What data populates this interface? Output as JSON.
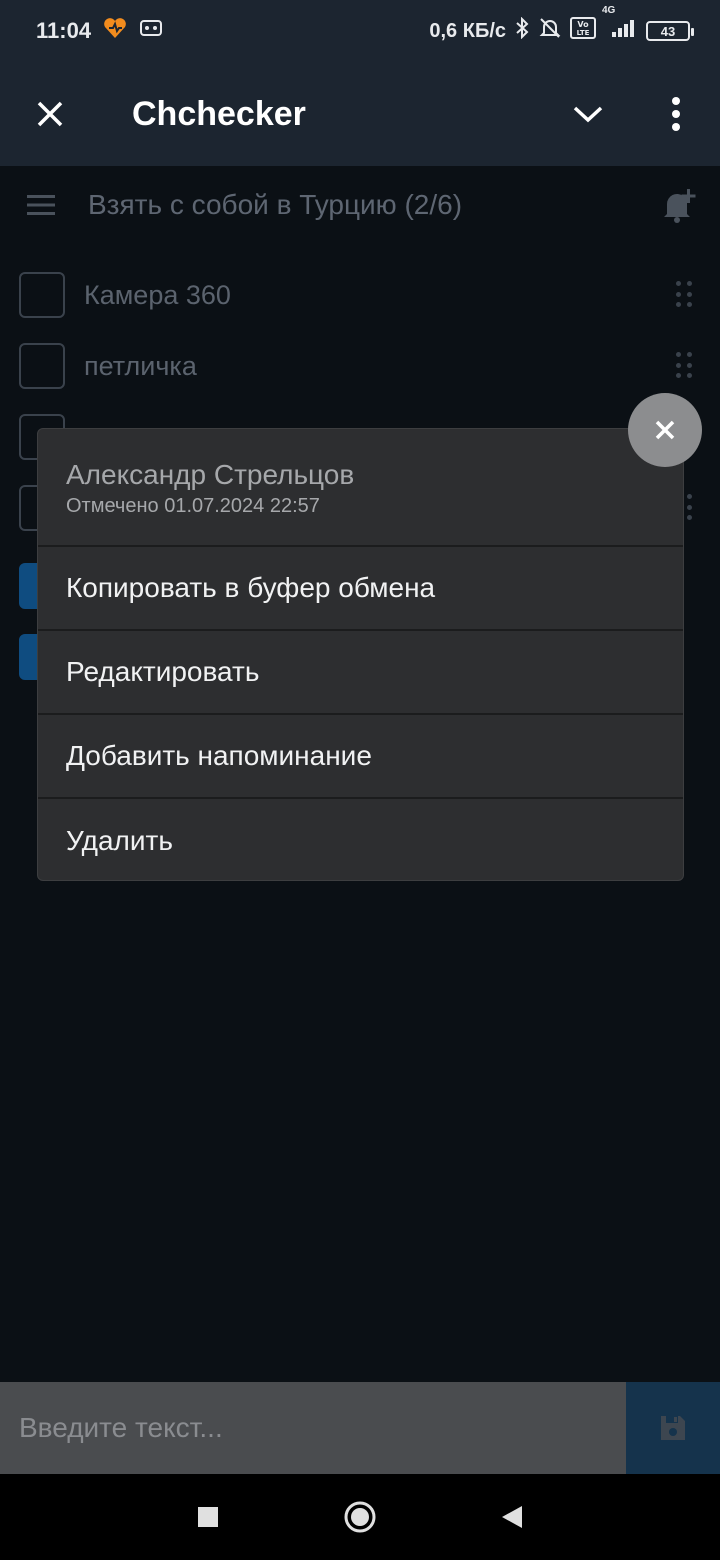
{
  "status_bar": {
    "time": "11:04",
    "speed": "0,6 КБ/с",
    "network": "4G",
    "battery": "43"
  },
  "app_bar": {
    "title": "Chchecker"
  },
  "list": {
    "title": "Взять с собой в Турцию (2/6)",
    "items": [
      {
        "label": "Камера 360"
      },
      {
        "label": "петличка"
      }
    ]
  },
  "context_menu": {
    "author": "Александр Стрельцов",
    "marked": "Отмечено 01.07.2024 22:57",
    "items": [
      {
        "label": "Копировать в буфер обмена"
      },
      {
        "label": "Редактировать"
      },
      {
        "label": "Добавить напоминание"
      },
      {
        "label": "Удалить"
      }
    ]
  },
  "input": {
    "placeholder": "Введите текст..."
  },
  "colors": {
    "app_bar": "#1c2530",
    "menu_bg": "#2d2e30",
    "checked": "#0f4c80",
    "fab": "#8c8d8f"
  }
}
